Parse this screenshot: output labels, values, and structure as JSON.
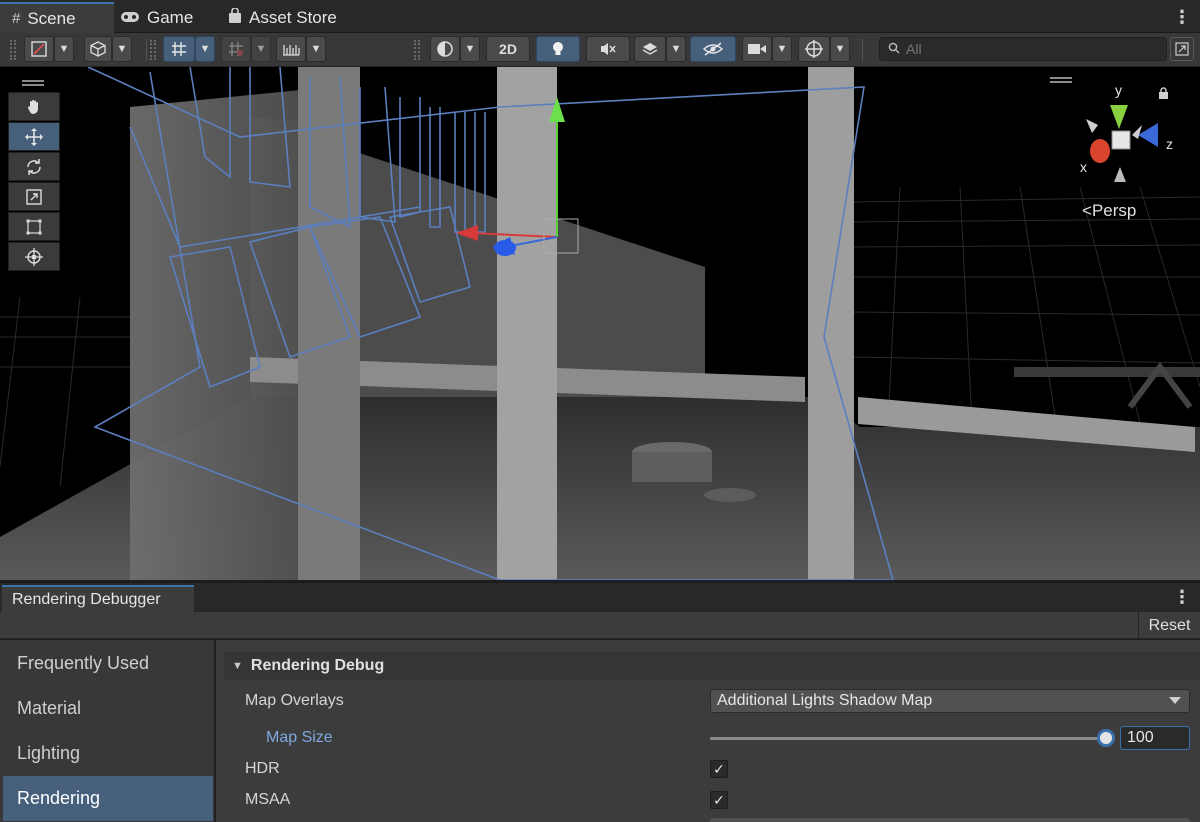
{
  "tabs": [
    {
      "label": "Scene",
      "icon": "grid-hash-icon"
    },
    {
      "label": "Game",
      "icon": "gamepad-icon"
    },
    {
      "label": "Asset Store",
      "icon": "shopping-bag-icon"
    }
  ],
  "toolbar": {
    "mode_2d_label": "2D",
    "search_placeholder": "All",
    "accent_color": "#46607c"
  },
  "scene_tools": [
    "hand-tool",
    "move-tool",
    "rotate-tool",
    "scale-tool",
    "rect-tool",
    "transform-tool"
  ],
  "viewport": {
    "projection_label": "Persp",
    "axes": {
      "x": "x",
      "y": "y",
      "z": "z"
    }
  },
  "debugger": {
    "tab_label": "Rendering Debugger",
    "reset_label": "Reset",
    "sidebar": [
      "Frequently Used",
      "Material",
      "Lighting",
      "Rendering"
    ],
    "selected_sidebar": "Rendering",
    "section_title": "Rendering Debug",
    "map_overlays": {
      "label": "Map Overlays",
      "value": "Additional Lights Shadow Map"
    },
    "map_size": {
      "label": "Map Size",
      "value": "100",
      "fraction": 1.0
    },
    "hdr": {
      "label": "HDR",
      "checked": true
    },
    "msaa": {
      "label": "MSAA",
      "checked": true
    }
  }
}
